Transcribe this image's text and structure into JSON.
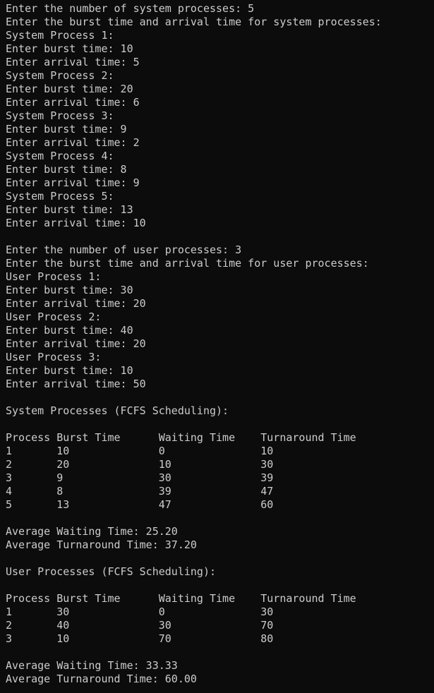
{
  "terminal": {
    "lines": [
      "Enter the number of system processes: 5",
      "Enter the burst time and arrival time for system processes:",
      "System Process 1:",
      "Enter burst time: 10",
      "Enter arrival time: 5",
      "System Process 2:",
      "Enter burst time: 20",
      "Enter arrival time: 6",
      "System Process 3:",
      "Enter burst time: 9",
      "Enter arrival time: 2",
      "System Process 4:",
      "Enter burst time: 8",
      "Enter arrival time: 9",
      "System Process 5:",
      "Enter burst time: 13",
      "Enter arrival time: 10",
      "",
      "Enter the number of user processes: 3",
      "Enter the burst time and arrival time for user processes:",
      "User Process 1:",
      "Enter burst time: 30",
      "Enter arrival time: 20",
      "User Process 2:",
      "Enter burst time: 40",
      "Enter arrival time: 20",
      "User Process 3:",
      "Enter burst time: 10",
      "Enter arrival time: 50",
      "",
      "System Processes (FCFS Scheduling):",
      "",
      "Process Burst Time      Waiting Time    Turnaround Time",
      "1       10              0               10",
      "2       20              10              30",
      "3       9               30              39",
      "4       8               39              47",
      "5       13              47              60",
      "",
      "Average Waiting Time: 25.20",
      "Average Turnaround Time: 37.20",
      "",
      "User Processes (FCFS Scheduling):",
      "",
      "Process Burst Time      Waiting Time    Turnaround Time",
      "1       30              0               30",
      "2       40              30              70",
      "3       10              70              80",
      "",
      "Average Waiting Time: 33.33",
      "Average Turnaround Time: 60.00"
    ]
  }
}
